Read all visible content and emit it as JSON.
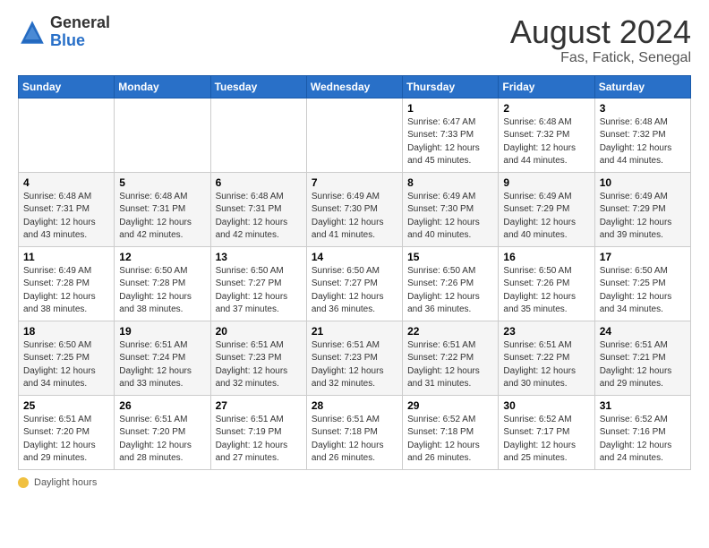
{
  "logo": {
    "general": "General",
    "blue": "Blue"
  },
  "title": "August 2024",
  "subtitle": "Fas, Fatick, Senegal",
  "days_header": [
    "Sunday",
    "Monday",
    "Tuesday",
    "Wednesday",
    "Thursday",
    "Friday",
    "Saturday"
  ],
  "weeks": [
    [
      {
        "day": "",
        "info": ""
      },
      {
        "day": "",
        "info": ""
      },
      {
        "day": "",
        "info": ""
      },
      {
        "day": "",
        "info": ""
      },
      {
        "day": "1",
        "info": "Sunrise: 6:47 AM\nSunset: 7:33 PM\nDaylight: 12 hours\nand 45 minutes."
      },
      {
        "day": "2",
        "info": "Sunrise: 6:48 AM\nSunset: 7:32 PM\nDaylight: 12 hours\nand 44 minutes."
      },
      {
        "day": "3",
        "info": "Sunrise: 6:48 AM\nSunset: 7:32 PM\nDaylight: 12 hours\nand 44 minutes."
      }
    ],
    [
      {
        "day": "4",
        "info": "Sunrise: 6:48 AM\nSunset: 7:31 PM\nDaylight: 12 hours\nand 43 minutes."
      },
      {
        "day": "5",
        "info": "Sunrise: 6:48 AM\nSunset: 7:31 PM\nDaylight: 12 hours\nand 42 minutes."
      },
      {
        "day": "6",
        "info": "Sunrise: 6:48 AM\nSunset: 7:31 PM\nDaylight: 12 hours\nand 42 minutes."
      },
      {
        "day": "7",
        "info": "Sunrise: 6:49 AM\nSunset: 7:30 PM\nDaylight: 12 hours\nand 41 minutes."
      },
      {
        "day": "8",
        "info": "Sunrise: 6:49 AM\nSunset: 7:30 PM\nDaylight: 12 hours\nand 40 minutes."
      },
      {
        "day": "9",
        "info": "Sunrise: 6:49 AM\nSunset: 7:29 PM\nDaylight: 12 hours\nand 40 minutes."
      },
      {
        "day": "10",
        "info": "Sunrise: 6:49 AM\nSunset: 7:29 PM\nDaylight: 12 hours\nand 39 minutes."
      }
    ],
    [
      {
        "day": "11",
        "info": "Sunrise: 6:49 AM\nSunset: 7:28 PM\nDaylight: 12 hours\nand 38 minutes."
      },
      {
        "day": "12",
        "info": "Sunrise: 6:50 AM\nSunset: 7:28 PM\nDaylight: 12 hours\nand 38 minutes."
      },
      {
        "day": "13",
        "info": "Sunrise: 6:50 AM\nSunset: 7:27 PM\nDaylight: 12 hours\nand 37 minutes."
      },
      {
        "day": "14",
        "info": "Sunrise: 6:50 AM\nSunset: 7:27 PM\nDaylight: 12 hours\nand 36 minutes."
      },
      {
        "day": "15",
        "info": "Sunrise: 6:50 AM\nSunset: 7:26 PM\nDaylight: 12 hours\nand 36 minutes."
      },
      {
        "day": "16",
        "info": "Sunrise: 6:50 AM\nSunset: 7:26 PM\nDaylight: 12 hours\nand 35 minutes."
      },
      {
        "day": "17",
        "info": "Sunrise: 6:50 AM\nSunset: 7:25 PM\nDaylight: 12 hours\nand 34 minutes."
      }
    ],
    [
      {
        "day": "18",
        "info": "Sunrise: 6:50 AM\nSunset: 7:25 PM\nDaylight: 12 hours\nand 34 minutes."
      },
      {
        "day": "19",
        "info": "Sunrise: 6:51 AM\nSunset: 7:24 PM\nDaylight: 12 hours\nand 33 minutes."
      },
      {
        "day": "20",
        "info": "Sunrise: 6:51 AM\nSunset: 7:23 PM\nDaylight: 12 hours\nand 32 minutes."
      },
      {
        "day": "21",
        "info": "Sunrise: 6:51 AM\nSunset: 7:23 PM\nDaylight: 12 hours\nand 32 minutes."
      },
      {
        "day": "22",
        "info": "Sunrise: 6:51 AM\nSunset: 7:22 PM\nDaylight: 12 hours\nand 31 minutes."
      },
      {
        "day": "23",
        "info": "Sunrise: 6:51 AM\nSunset: 7:22 PM\nDaylight: 12 hours\nand 30 minutes."
      },
      {
        "day": "24",
        "info": "Sunrise: 6:51 AM\nSunset: 7:21 PM\nDaylight: 12 hours\nand 29 minutes."
      }
    ],
    [
      {
        "day": "25",
        "info": "Sunrise: 6:51 AM\nSunset: 7:20 PM\nDaylight: 12 hours\nand 29 minutes."
      },
      {
        "day": "26",
        "info": "Sunrise: 6:51 AM\nSunset: 7:20 PM\nDaylight: 12 hours\nand 28 minutes."
      },
      {
        "day": "27",
        "info": "Sunrise: 6:51 AM\nSunset: 7:19 PM\nDaylight: 12 hours\nand 27 minutes."
      },
      {
        "day": "28",
        "info": "Sunrise: 6:51 AM\nSunset: 7:18 PM\nDaylight: 12 hours\nand 26 minutes."
      },
      {
        "day": "29",
        "info": "Sunrise: 6:52 AM\nSunset: 7:18 PM\nDaylight: 12 hours\nand 26 minutes."
      },
      {
        "day": "30",
        "info": "Sunrise: 6:52 AM\nSunset: 7:17 PM\nDaylight: 12 hours\nand 25 minutes."
      },
      {
        "day": "31",
        "info": "Sunrise: 6:52 AM\nSunset: 7:16 PM\nDaylight: 12 hours\nand 24 minutes."
      }
    ]
  ],
  "footer": {
    "icon_label": "daylight-icon",
    "text": "Daylight hours"
  }
}
